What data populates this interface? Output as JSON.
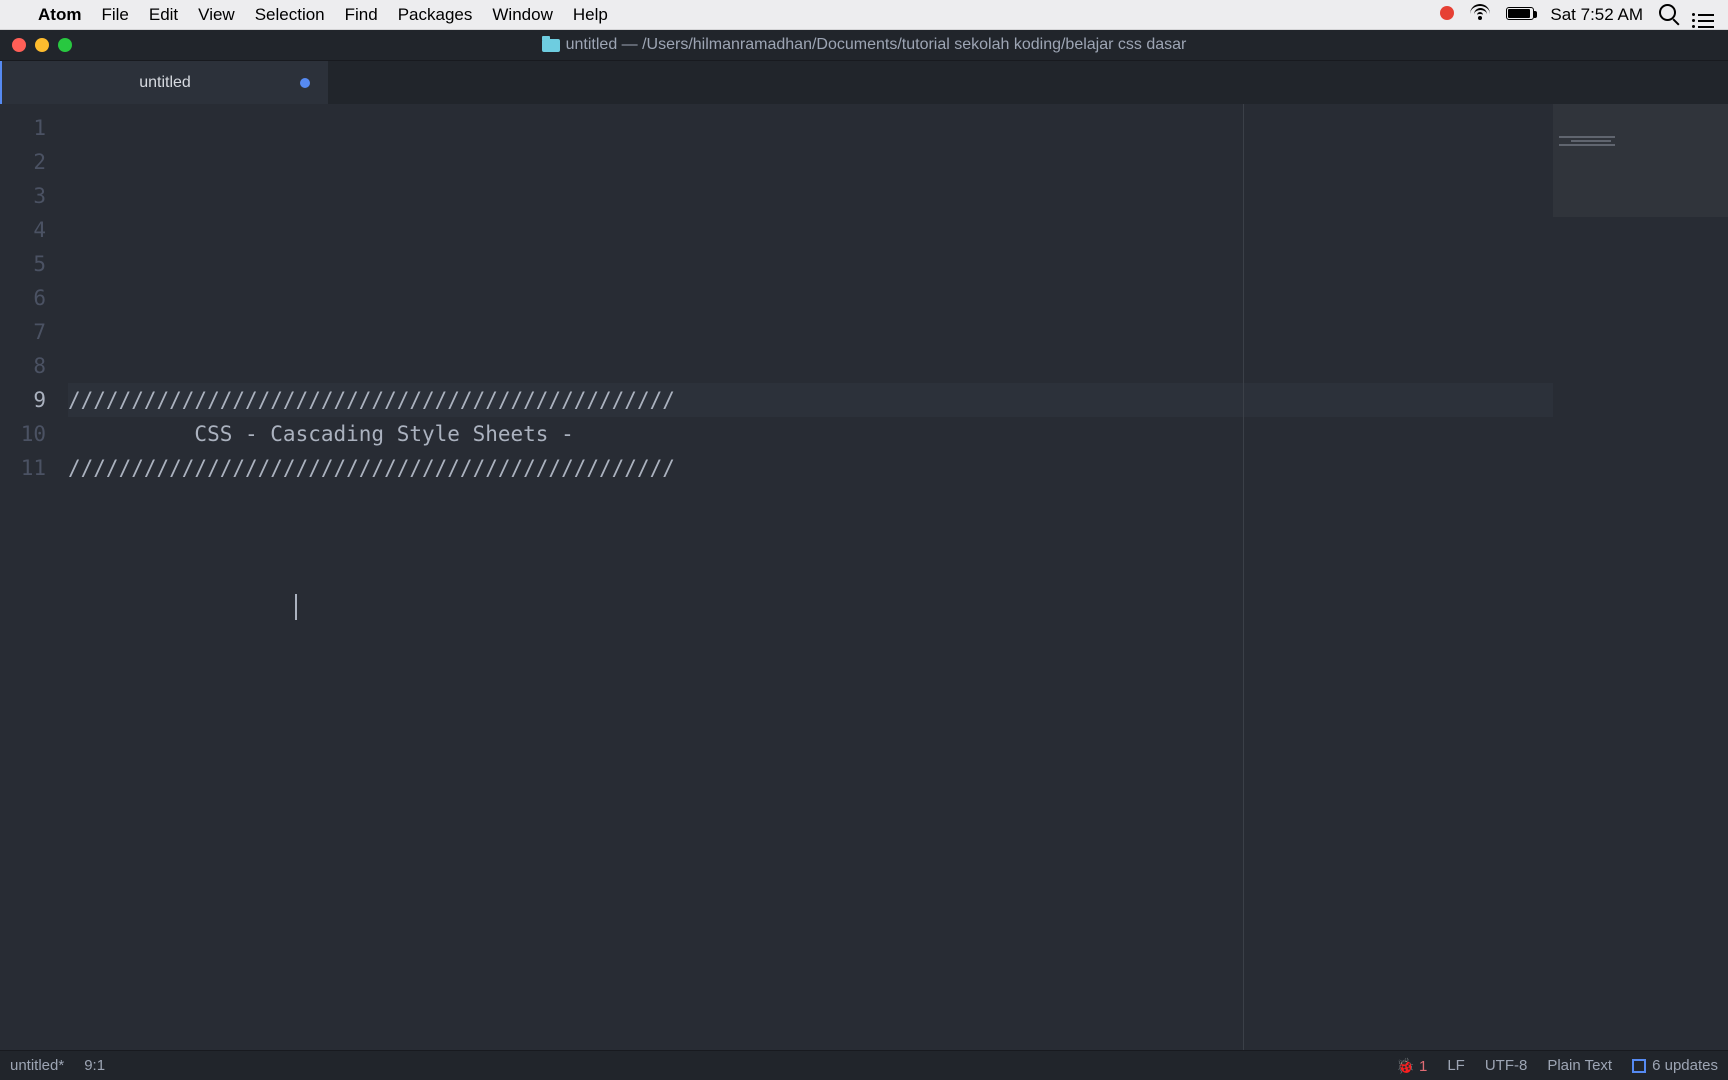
{
  "menubar": {
    "app": "Atom",
    "items": [
      "File",
      "Edit",
      "View",
      "Selection",
      "Find",
      "Packages",
      "Window",
      "Help"
    ],
    "clock": "Sat 7:52 AM"
  },
  "window": {
    "title": "untitled — /Users/hilmanramadhan/Documents/tutorial sekolah koding/belajar css dasar"
  },
  "tab": {
    "name": "untitled",
    "dirty": true
  },
  "editor": {
    "total_lines": 11,
    "active_line": 9,
    "lines": {
      "1": "",
      "2": "",
      "3": "",
      "4": "",
      "5": "",
      "6": "",
      "7": "",
      "8": "",
      "9": "////////////////////////////////////////////////",
      "10": "          CSS - Cascading Style Sheets -",
      "11": "////////////////////////////////////////////////"
    }
  },
  "statusbar": {
    "file": "untitled*",
    "cursor": "9:1",
    "diagnostics": "1",
    "line_ending": "LF",
    "encoding": "UTF-8",
    "grammar": "Plain Text",
    "updates": "6 updates"
  }
}
